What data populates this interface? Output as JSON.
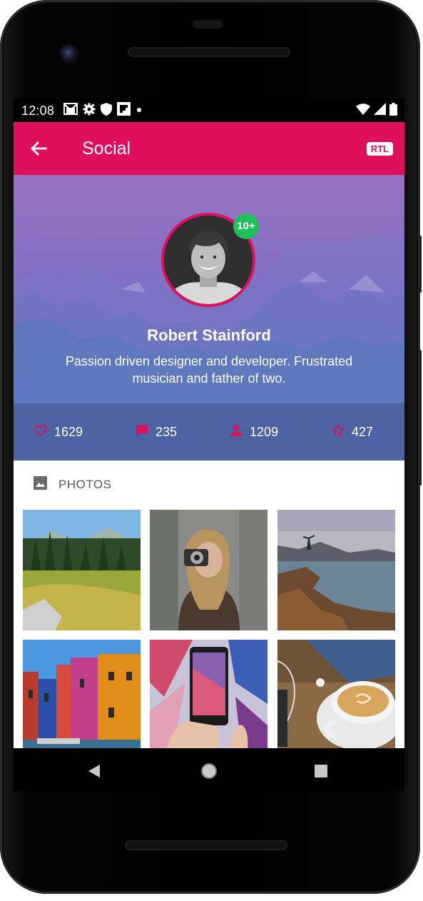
{
  "status": {
    "time": "12:08"
  },
  "appbar": {
    "title": "Social",
    "rtl_label": "RTL"
  },
  "profile": {
    "name": "Robert Stainford",
    "bio": "Passion driven designer and developer. Frustrated musician and father of two.",
    "badge": "10+"
  },
  "stats": [
    {
      "icon": "heart-icon",
      "value": "1629"
    },
    {
      "icon": "comment-icon",
      "value": "235"
    },
    {
      "icon": "person-icon",
      "value": "1209"
    },
    {
      "icon": "star-icon",
      "value": "427"
    }
  ],
  "photos": {
    "title": "PHOTOS",
    "items": [
      {
        "name": "photo-forest-meadow"
      },
      {
        "name": "photo-woman-camera"
      },
      {
        "name": "photo-coast-sunset"
      },
      {
        "name": "photo-colorful-houses"
      },
      {
        "name": "photo-phone-mural"
      },
      {
        "name": "photo-coffee-earphones"
      }
    ]
  },
  "colors": {
    "accent": "#de0f5d",
    "badge_green": "#1fbf5c"
  }
}
